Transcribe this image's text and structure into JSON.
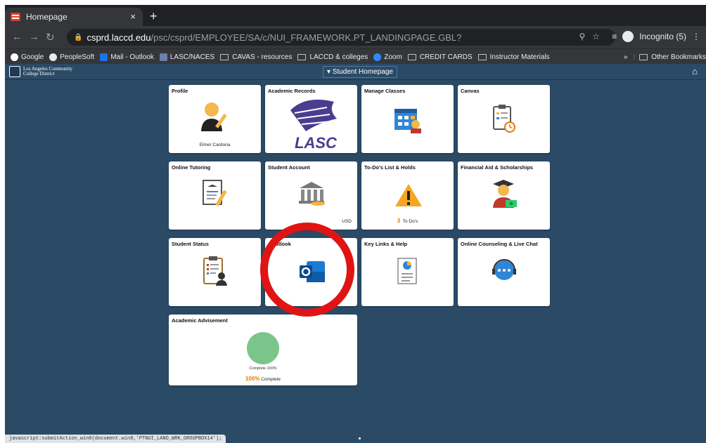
{
  "browser": {
    "tab_title": "Homepage",
    "tab_close": "×",
    "new_tab": "+",
    "url_host": "csprd.laccd.edu",
    "url_path": "/psc/csprd/EMPLOYEE/SA/c/NUI_FRAMEWORK.PT_LANDINGPAGE.GBL?",
    "incognito_label": "Incognito (5)",
    "bookmarks": [
      "Google",
      "PeopleSoft",
      "Mail - Outlook",
      "LASC/NACES",
      "CAVAS - resources",
      "LACCD & colleges",
      "Zoom",
      "CREDIT CARDS",
      "Instructor Materials"
    ],
    "other_bookmarks": "Other Bookmarks",
    "more_bookmarks": "»"
  },
  "header": {
    "logo_line1": "Los Angeles Community",
    "logo_line2": "College District",
    "page_title": "▾ Student Homepage"
  },
  "tiles": {
    "profile": {
      "title": "Profile",
      "subtitle": "Elmer Cardona"
    },
    "academic_records": {
      "title": "Academic Records"
    },
    "manage_classes": {
      "title": "Manage Classes"
    },
    "canvas": {
      "title": "Canvas"
    },
    "online_tutoring": {
      "title": "Online Tutoring"
    },
    "student_account": {
      "title": "Student Account",
      "subtitle": "USD"
    },
    "todos": {
      "title": "To-Do's List & Holds",
      "count": "3",
      "subtitle": "To Do's"
    },
    "financial_aid": {
      "title": "Financial Aid & Scholarships"
    },
    "student_status": {
      "title": "Student Status"
    },
    "outlook": {
      "title": "- Outlook"
    },
    "key_links": {
      "title": "Key Links & Help"
    },
    "counseling": {
      "title": "Online Counseling & Live Chat"
    },
    "advisement": {
      "title": "Academic Advisement",
      "circle_label": "Complete 100%",
      "percent": "100%",
      "complete_label": "Complete"
    }
  },
  "status_bar": "javascript:submitAction_win0(document.win0,'PTNUI_LAND_WRK_GROUPBOX14');",
  "colors": {
    "page_bg": "#2b4a66",
    "highlight_ring": "#e01414",
    "progress_circle": "#7cc58a",
    "percent_text": "#e07b00"
  }
}
